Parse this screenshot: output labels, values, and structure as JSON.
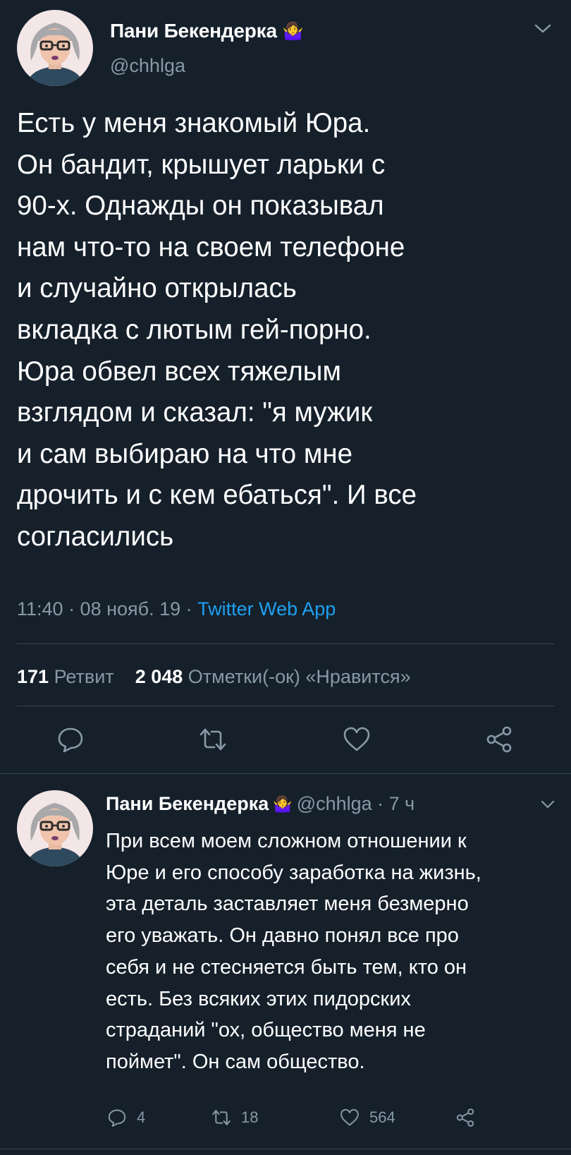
{
  "main_tweet": {
    "author_name": "Пани Бекендерка",
    "author_emoji": "🤷‍♀️",
    "handle": "@chhlga",
    "text_lines": [
      "Есть у меня знакомый Юра.",
      "Он бандит, крышует ларьки с",
      "90-х. Однажды он показывал",
      "нам что-то на своем телефоне",
      "и случайно открылась",
      "вкладка с лютым гей-порно.",
      "Юра обвел всех тяжелым",
      "взглядом и сказал: \"я мужик",
      "и сам выбираю на что мне",
      "дрочить и с кем ебаться\". И все",
      "согласились"
    ],
    "timestamp": "11:40 · 08 нояб. 19 · ",
    "source": "Twitter Web App",
    "retweets_count": "171",
    "retweets_label": "Ретвит",
    "likes_count": "2 048",
    "likes_label": "Отметки(-ок) «Нравится»"
  },
  "reply_tweet": {
    "author_name": "Пани Бекендерка",
    "author_emoji": "🤷‍♀️",
    "meta": "@chhlga · 7 ч",
    "text_lines": [
      "При всем моем сложном отношении к",
      "Юре и его способу заработка на жизнь,",
      "эта деталь заставляет меня безмерно",
      "его уважать. Он давно понял все про",
      "себя и не стесняется быть тем, кто он",
      "есть. Без всяких этих пидорских",
      "страданий \"ох, общество меня не",
      "поймет\". Он сам общество."
    ],
    "reply_count": "4",
    "retweet_count": "18",
    "like_count": "564"
  },
  "icons": {
    "reply": "reply-icon",
    "retweet": "retweet-icon",
    "like": "heart-icon",
    "share": "share-icon",
    "more": "chevron-down-icon"
  },
  "colors": {
    "background": "#15202b",
    "secondary_text": "#8899a6",
    "link": "#1da1f2",
    "divider": "#38444d"
  }
}
